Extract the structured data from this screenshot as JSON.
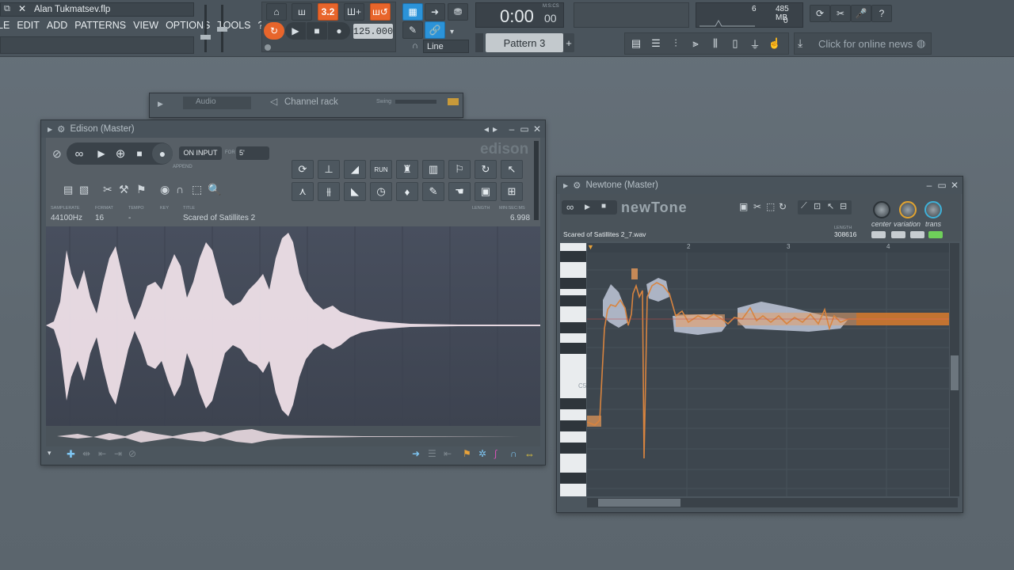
{
  "project": {
    "title": "Alan Tukmatsev.flp"
  },
  "menu": [
    "FILE",
    "EDIT",
    "ADD",
    "PATTERNS",
    "VIEW",
    "OPTIONS",
    "TOOLS",
    "?"
  ],
  "transport": {
    "tempo": "125.000",
    "time": "0:00",
    "time_sub": "00",
    "time_label": "M:S:CS",
    "pattern": "Pattern 3",
    "snap": "Line"
  },
  "cpu": {
    "value": "6",
    "memory": "485 MB",
    "polyphony": "0"
  },
  "news": {
    "text": "Click for online news"
  },
  "channel_rack": {
    "title": "Channel rack",
    "filter": "Audio",
    "swing_label": "Swing"
  },
  "edison": {
    "title": "Edison (Master)",
    "logo": "edison",
    "on_input": "ON INPUT",
    "for_label": "FOR",
    "for_value": "5'",
    "append": "APPEND",
    "run_label": "RUN",
    "samplerate_label": "SAMPLERATE",
    "format_label": "FORMAT",
    "tempo_label": "TEMPO",
    "key_label": "KEY",
    "title_label": "TITLE",
    "length_label": "LENGTH",
    "selection_label": "MIN:SEC:MS",
    "samplerate": "44100Hz",
    "format": "16",
    "tempo": "-",
    "key": "-",
    "sample_title": "Scared of Satillites 2",
    "length": "6.998"
  },
  "newtone": {
    "title": "Newtone (Master)",
    "logo": "newTone",
    "file": "Scared of Satillites 2_7.wav",
    "samples_label": "LENGTH",
    "samples": "308616",
    "knobs": [
      "center",
      "variation",
      "trans"
    ],
    "ruler": [
      "2",
      "3",
      "4"
    ],
    "note_label": "C5"
  },
  "colors": {
    "accent": "#e8652b",
    "blue": "#2b93d9",
    "pitch": "#d8843f",
    "wave": "#f3e4ec"
  }
}
